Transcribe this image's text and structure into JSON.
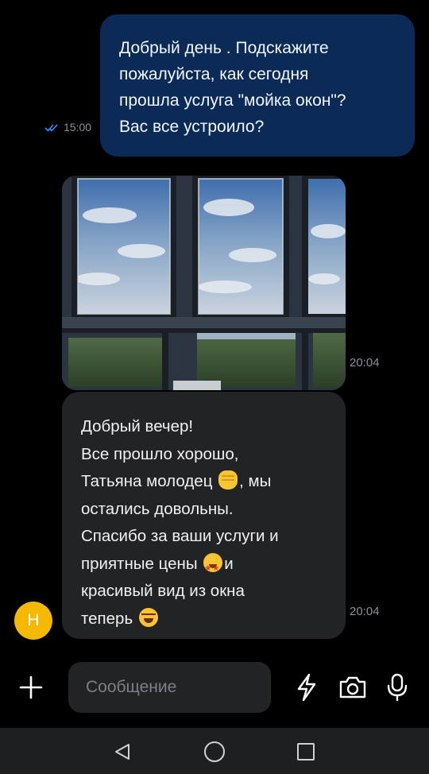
{
  "messages": {
    "outgoing": {
      "text_lines": [
        "Добрый день . Подскажите",
        "пожалуйста, как сегодня",
        "прошла услуга \"мойка окон\"?",
        "Вас все устроило?"
      ],
      "time": "15:00",
      "status_icon": "double-check-icon",
      "bubble_color": "#0b2a55"
    },
    "photo": {
      "description_icon": "photo-window-view",
      "time": "20:04"
    },
    "incoming": {
      "l1": "Добрый вечер!",
      "l2": "Все прошло хорошо,",
      "l3a": "Татьяна молодец ",
      "l3b": ", мы",
      "l4": "остались довольны.",
      "l5": "Спасибо за ваши услуги и",
      "l6a": "приятные цены ",
      "l6b": "и",
      "l7": "красивый вид из окна",
      "l8": "теперь ",
      "time": "20:04",
      "bubble_color": "#222325"
    },
    "avatar_letter": "Н"
  },
  "composer": {
    "placeholder": "Сообщение",
    "icons": [
      "plus-icon",
      "lightning-icon",
      "camera-icon",
      "microphone-icon"
    ]
  },
  "navbar": {
    "icons": [
      "back-icon",
      "home-icon",
      "recents-icon"
    ]
  },
  "colors": {
    "accent": "#0b2a55",
    "avatar": "#f4b900",
    "tick": "#3f8cff"
  }
}
